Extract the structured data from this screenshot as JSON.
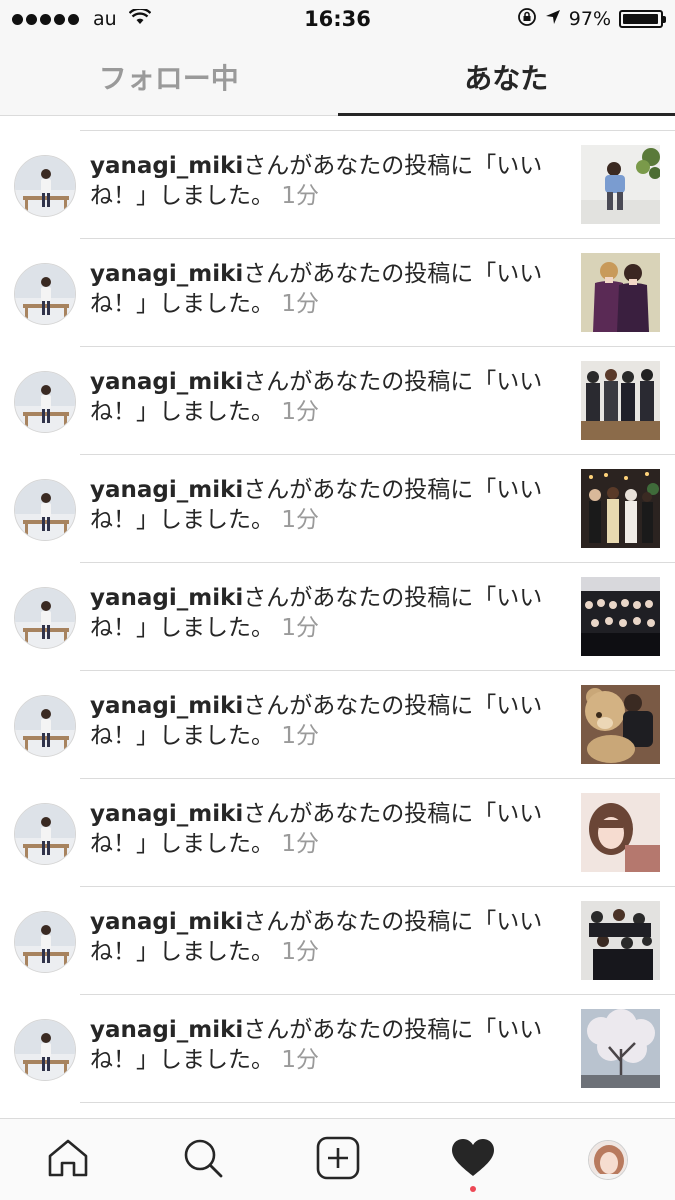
{
  "status_bar": {
    "carrier": "au",
    "time": "16:36",
    "battery_percent": "97%",
    "battery_level": 0.97
  },
  "tabs": [
    {
      "label": "フォロー中",
      "active": false
    },
    {
      "label": "あなた",
      "active": true
    }
  ],
  "notifications": [
    {
      "username": "yanagi_miki",
      "message": "さんがあなたの投稿に「いいね！」しました。",
      "time": "1分",
      "thumbnail": "girl-posing-white-room"
    },
    {
      "username": "yanagi_miki",
      "message": "さんがあなたの投稿に「いいね！」しました。",
      "time": "1分",
      "thumbnail": "two-girls-purple"
    },
    {
      "username": "yanagi_miki",
      "message": "さんがあなたの投稿に「いいね！」しました。",
      "time": "1分",
      "thumbnail": "group-dark-clothes"
    },
    {
      "username": "yanagi_miki",
      "message": "さんがあなたの投稿に「いいね！」しました。",
      "time": "1分",
      "thumbnail": "group-party-lights"
    },
    {
      "username": "yanagi_miki",
      "message": "さんがあなたの投稿に「いいね！」しました。",
      "time": "1分",
      "thumbnail": "large-group-photo"
    },
    {
      "username": "yanagi_miki",
      "message": "さんがあなたの投稿に「いいね！」しました。",
      "time": "1分",
      "thumbnail": "teddy-bear-hug"
    },
    {
      "username": "yanagi_miki",
      "message": "さんがあなたの投稿に「いいね！」しました。",
      "time": "1分",
      "thumbnail": "girl-portrait-pink"
    },
    {
      "username": "yanagi_miki",
      "message": "さんがあなたの投稿に「いいね！」しました。",
      "time": "1分",
      "thumbnail": "group-selfie"
    },
    {
      "username": "yanagi_miki",
      "message": "さんがあなたの投稿に「いいね！」しました。",
      "time": "1分",
      "thumbnail": "cherry-blossom-tree"
    }
  ],
  "bottom_nav": [
    {
      "icon": "home-icon"
    },
    {
      "icon": "search-icon"
    },
    {
      "icon": "add-post-icon"
    },
    {
      "icon": "heart-icon",
      "active": true,
      "has_notification_dot": true
    },
    {
      "icon": "profile-avatar"
    }
  ],
  "colors": {
    "text": "#262626",
    "muted": "#9a9a9a",
    "divider": "#dbdbdb",
    "notification_dot": "#ed4956"
  }
}
